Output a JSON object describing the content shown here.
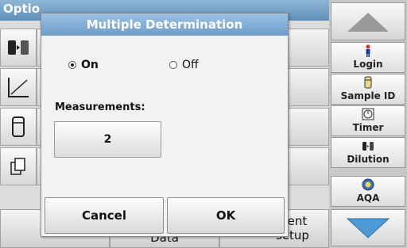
{
  "app": {
    "header_title": "Optio"
  },
  "background": {
    "bottom_tiles": [
      "",
      "Data",
      "ment setup"
    ]
  },
  "right_panel": {
    "nav_up_icon": "triangle-up",
    "nav_down_icon": "triangle-down",
    "buttons": [
      {
        "label": "Login",
        "icon": "person-icon"
      },
      {
        "label": "Sample ID",
        "icon": "vial-icon"
      },
      {
        "label": "Timer",
        "icon": "timer-icon"
      },
      {
        "label": "Dilution",
        "icon": "dilution-icon"
      },
      {
        "label": "AQA",
        "icon": "aqa-icon"
      }
    ]
  },
  "dialog": {
    "title": "Multiple Determination",
    "options": [
      {
        "label": "On",
        "selected": true
      },
      {
        "label": "Off",
        "selected": false
      }
    ],
    "measurements_label": "Measurements:",
    "measurements_value": "2",
    "cancel_label": "Cancel",
    "ok_label": "OK"
  },
  "colors": {
    "title_bar": "#6d9ccb",
    "nav_arrow": "#5b9fd6"
  }
}
